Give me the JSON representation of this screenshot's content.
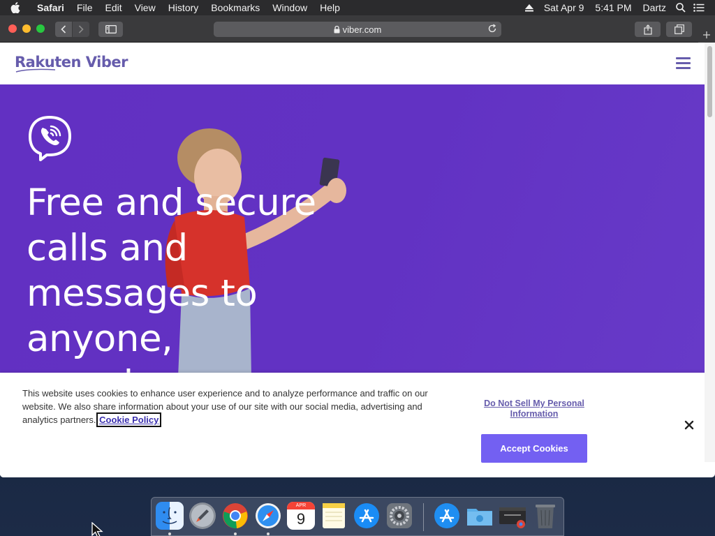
{
  "menubar": {
    "app_name": "Safari",
    "items": [
      "File",
      "Edit",
      "View",
      "History",
      "Bookmarks",
      "Window",
      "Help"
    ],
    "date": "Sat Apr 9",
    "time": "5:41 PM",
    "user": "Dartz"
  },
  "browser": {
    "url": "viber.com"
  },
  "site": {
    "logo_text": "Rakuten Viber",
    "hero_title": "Free and secure calls and messages to anyone, anywhere"
  },
  "cookie_banner": {
    "text": "This website uses cookies to enhance user experience and to analyze performance and traffic on our website. We also share information about your use of our site with our social media, advertising and analytics partners.",
    "policy_link": "Cookie Policy",
    "do_not_sell": "Do Not Sell My Personal Information",
    "accept_button": "Accept Cookies"
  },
  "dock": {
    "apps": [
      "finder-icon",
      "launchpad-icon",
      "chrome-icon",
      "safari-icon",
      "calendar-icon",
      "notes-icon",
      "app-store-icon",
      "system-preferences-icon",
      "applications-folder-icon",
      "documents-folder-icon",
      "chrome-window-icon",
      "trash-icon"
    ],
    "calendar_month": "APR",
    "calendar_day": "9"
  },
  "colors": {
    "viber_purple": "#665cac",
    "hero_purple": "#6230c2",
    "accept_button": "#7360f2"
  }
}
